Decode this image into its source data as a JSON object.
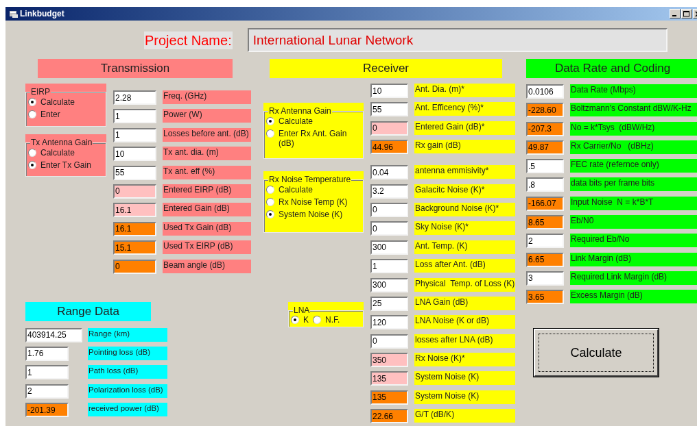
{
  "window": {
    "title": "Linkbudget"
  },
  "project": {
    "label": "Project Name:",
    "value": "International Lunar Network"
  },
  "transmission": {
    "title": "Transmission",
    "groups": [
      {
        "title": "EIRP",
        "options": [
          {
            "label": "Calculate",
            "selected": true
          },
          {
            "label": "Enter",
            "selected": false
          }
        ]
      },
      {
        "title": "Tx Antenna Gain",
        "options": [
          {
            "label": "Calculate",
            "selected": false
          },
          {
            "label": "Enter Tx Gain",
            "selected": true
          }
        ]
      }
    ],
    "rows": [
      {
        "value": "2.28",
        "label": "Freq. (GHz)",
        "kind": "input"
      },
      {
        "value": "1",
        "label": "Power (W)",
        "kind": "input"
      },
      {
        "value": "1",
        "label": "Losses before ant. (dB)",
        "kind": "input"
      },
      {
        "value": "10",
        "label": "Tx ant. dia. (m)",
        "kind": "input"
      },
      {
        "value": "55",
        "label": "Tx ant. eff (%)",
        "kind": "input"
      },
      {
        "value": "0",
        "label": "Entered EIRP (dB)",
        "kind": "entered"
      },
      {
        "value": "16.1",
        "label": "Entered Gain (dB)",
        "kind": "entered"
      },
      {
        "value": "16.1",
        "label": "Used Tx Gain (dB)",
        "kind": "output"
      },
      {
        "value": "15.1",
        "label": "Used Tx EIRP (dB)",
        "kind": "output"
      },
      {
        "value": "0",
        "label": "Beam angle (dB)",
        "kind": "output"
      }
    ]
  },
  "range": {
    "title": "Range Data",
    "rows": [
      {
        "value": "403914.25",
        "label": "Range (km)",
        "kind": "input"
      },
      {
        "value": "1.76",
        "label": "Pointing loss (dB)",
        "kind": "input"
      },
      {
        "value": "1",
        "label": "Path loss (dB)",
        "kind": "input"
      },
      {
        "value": "2",
        "label": "Polarization loss (dB)",
        "kind": "input"
      },
      {
        "value": "-201.39",
        "label": "received power (dB)",
        "kind": "output"
      }
    ]
  },
  "receiver": {
    "title": "Receiver",
    "antenna_group": {
      "title": "Rx Antenna Gain",
      "options": [
        {
          "label": "Calculate",
          "selected": true
        },
        {
          "label": "Enter Rx Ant. Gain (dB)",
          "selected": false
        }
      ]
    },
    "noise_group": {
      "title": "Rx Noise Temperature",
      "options": [
        {
          "label": "Calculate",
          "selected": false
        },
        {
          "label": "Rx Noise Temp (K)",
          "selected": false
        },
        {
          "label": "System Noise (K)",
          "selected": true
        }
      ]
    },
    "lna_group": {
      "title": "LNA",
      "options": [
        {
          "label": "K",
          "selected": true
        },
        {
          "label": "N.F.",
          "selected": false
        }
      ]
    },
    "antenna_rows": [
      {
        "value": "10",
        "label": "Ant. Dia. (m)*",
        "kind": "input"
      },
      {
        "value": "55",
        "label": "Ant. Efficency (%)*",
        "kind": "input"
      },
      {
        "value": "0",
        "label": "Entered Gain (dB)*",
        "kind": "entered"
      },
      {
        "value": "44.96",
        "label": "Rx gain (dB)",
        "kind": "output"
      }
    ],
    "noise_rows": [
      {
        "value": "0.04",
        "label": "antenna emmisivity*",
        "kind": "input"
      },
      {
        "value": "3.2",
        "label": "Galacitc Noise (K)*",
        "kind": "input"
      },
      {
        "value": "0",
        "label": "Background Noise (K)*",
        "kind": "input"
      },
      {
        "value": "0",
        "label": "Sky Noise (K)*",
        "kind": "input"
      },
      {
        "value": "300",
        "label": "Ant. Temp. (K)",
        "kind": "input"
      },
      {
        "value": "1",
        "label": "Loss after Ant. (dB)",
        "kind": "input"
      },
      {
        "value": "300",
        "label": "Physical  Temp. of Loss (K)",
        "kind": "input"
      },
      {
        "value": "25",
        "label": "LNA Gain (dB)",
        "kind": "input"
      },
      {
        "value": "120",
        "label": "LNA Noise (K or dB)",
        "kind": "input"
      },
      {
        "value": "0",
        "label": "losses after LNA (dB)",
        "kind": "input"
      },
      {
        "value": "350",
        "label": "Rx Noise (K)*",
        "kind": "entered"
      },
      {
        "value": "135",
        "label": "System Noise (K)",
        "kind": "entered"
      },
      {
        "value": "135",
        "label": "System Noise (K)",
        "kind": "output"
      },
      {
        "value": "22.66",
        "label": "G/T (dB/K)",
        "kind": "output"
      }
    ]
  },
  "data_rate": {
    "title": "Data Rate and Coding",
    "rows": [
      {
        "value": "0.0106",
        "label": "Data Rate (Mbps)",
        "kind": "input"
      },
      {
        "value": "-228.60",
        "label": "Boltzmann's Constant dBW/K-Hz",
        "kind": "output"
      },
      {
        "value": "-207.3",
        "label": "No = k*Tsys  (dBW/Hz)",
        "kind": "output"
      },
      {
        "value": "49.87",
        "label": "Rx Carrier/No   (dBHz)",
        "kind": "output"
      },
      {
        "value": ".5",
        "label": "FEC rate (refernce only)",
        "kind": "input"
      },
      {
        "value": ".8",
        "label": "data bits per frame bits",
        "kind": "input"
      },
      {
        "value": "-166.07",
        "label": "Input Noise  N = k*B*T",
        "kind": "output"
      },
      {
        "value": "8.65",
        "label": "Eb/N0",
        "kind": "output"
      },
      {
        "value": "2",
        "label": "Required Eb/No",
        "kind": "input"
      },
      {
        "value": "6.65",
        "label": "Link Margin (dB)",
        "kind": "output"
      },
      {
        "value": "3",
        "label": "Required Link Margin (dB)",
        "kind": "input"
      },
      {
        "value": "3.65",
        "label": "Excess Margin (dB)",
        "kind": "output"
      }
    ]
  },
  "calculate_button": "Calculate"
}
